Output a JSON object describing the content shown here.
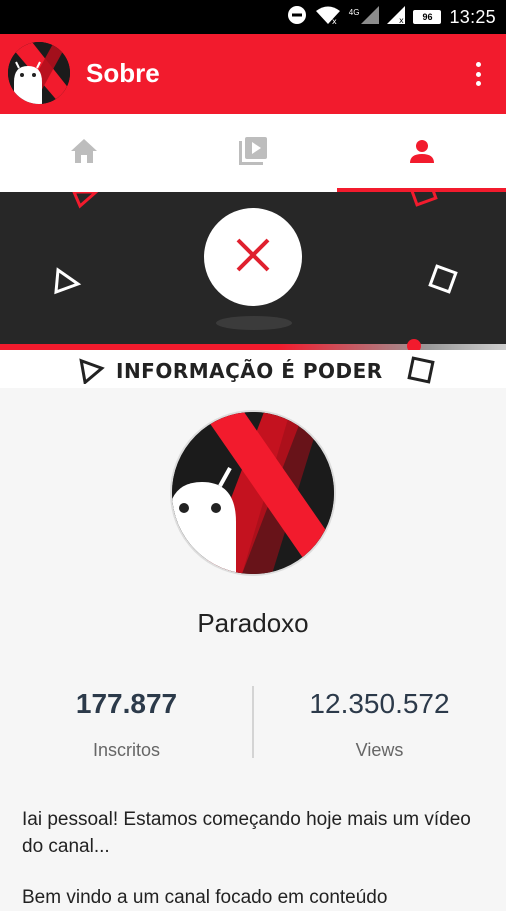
{
  "status_bar": {
    "time": "13:25",
    "battery": "96",
    "network": "4G",
    "icons": [
      "do-not-disturb-icon",
      "wifi-icon",
      "signal-icon",
      "signal-icon",
      "battery-icon"
    ]
  },
  "app_bar": {
    "title": "Sobre",
    "menu_icon": "more-vert-icon"
  },
  "tabs": [
    {
      "icon": "home-icon",
      "active": false
    },
    {
      "icon": "video-library-icon",
      "active": false
    },
    {
      "icon": "person-icon",
      "active": true
    }
  ],
  "banner": {
    "motto": "INFORMAÇÃO É PODER"
  },
  "profile": {
    "name": "Paradoxo",
    "subscribers_value": "177.877",
    "subscribers_label": "Inscritos",
    "views_value": "12.350.572",
    "views_label": "Views"
  },
  "description": {
    "line1": "Iai pessoal! Estamos começando hoje mais um vídeo do canal...",
    "line2": "Bem vindo a um canal focado em conteúdo"
  },
  "colors": {
    "accent": "#f21b2d",
    "banner_bg": "#272727",
    "stat_text": "#2c3a4a"
  }
}
